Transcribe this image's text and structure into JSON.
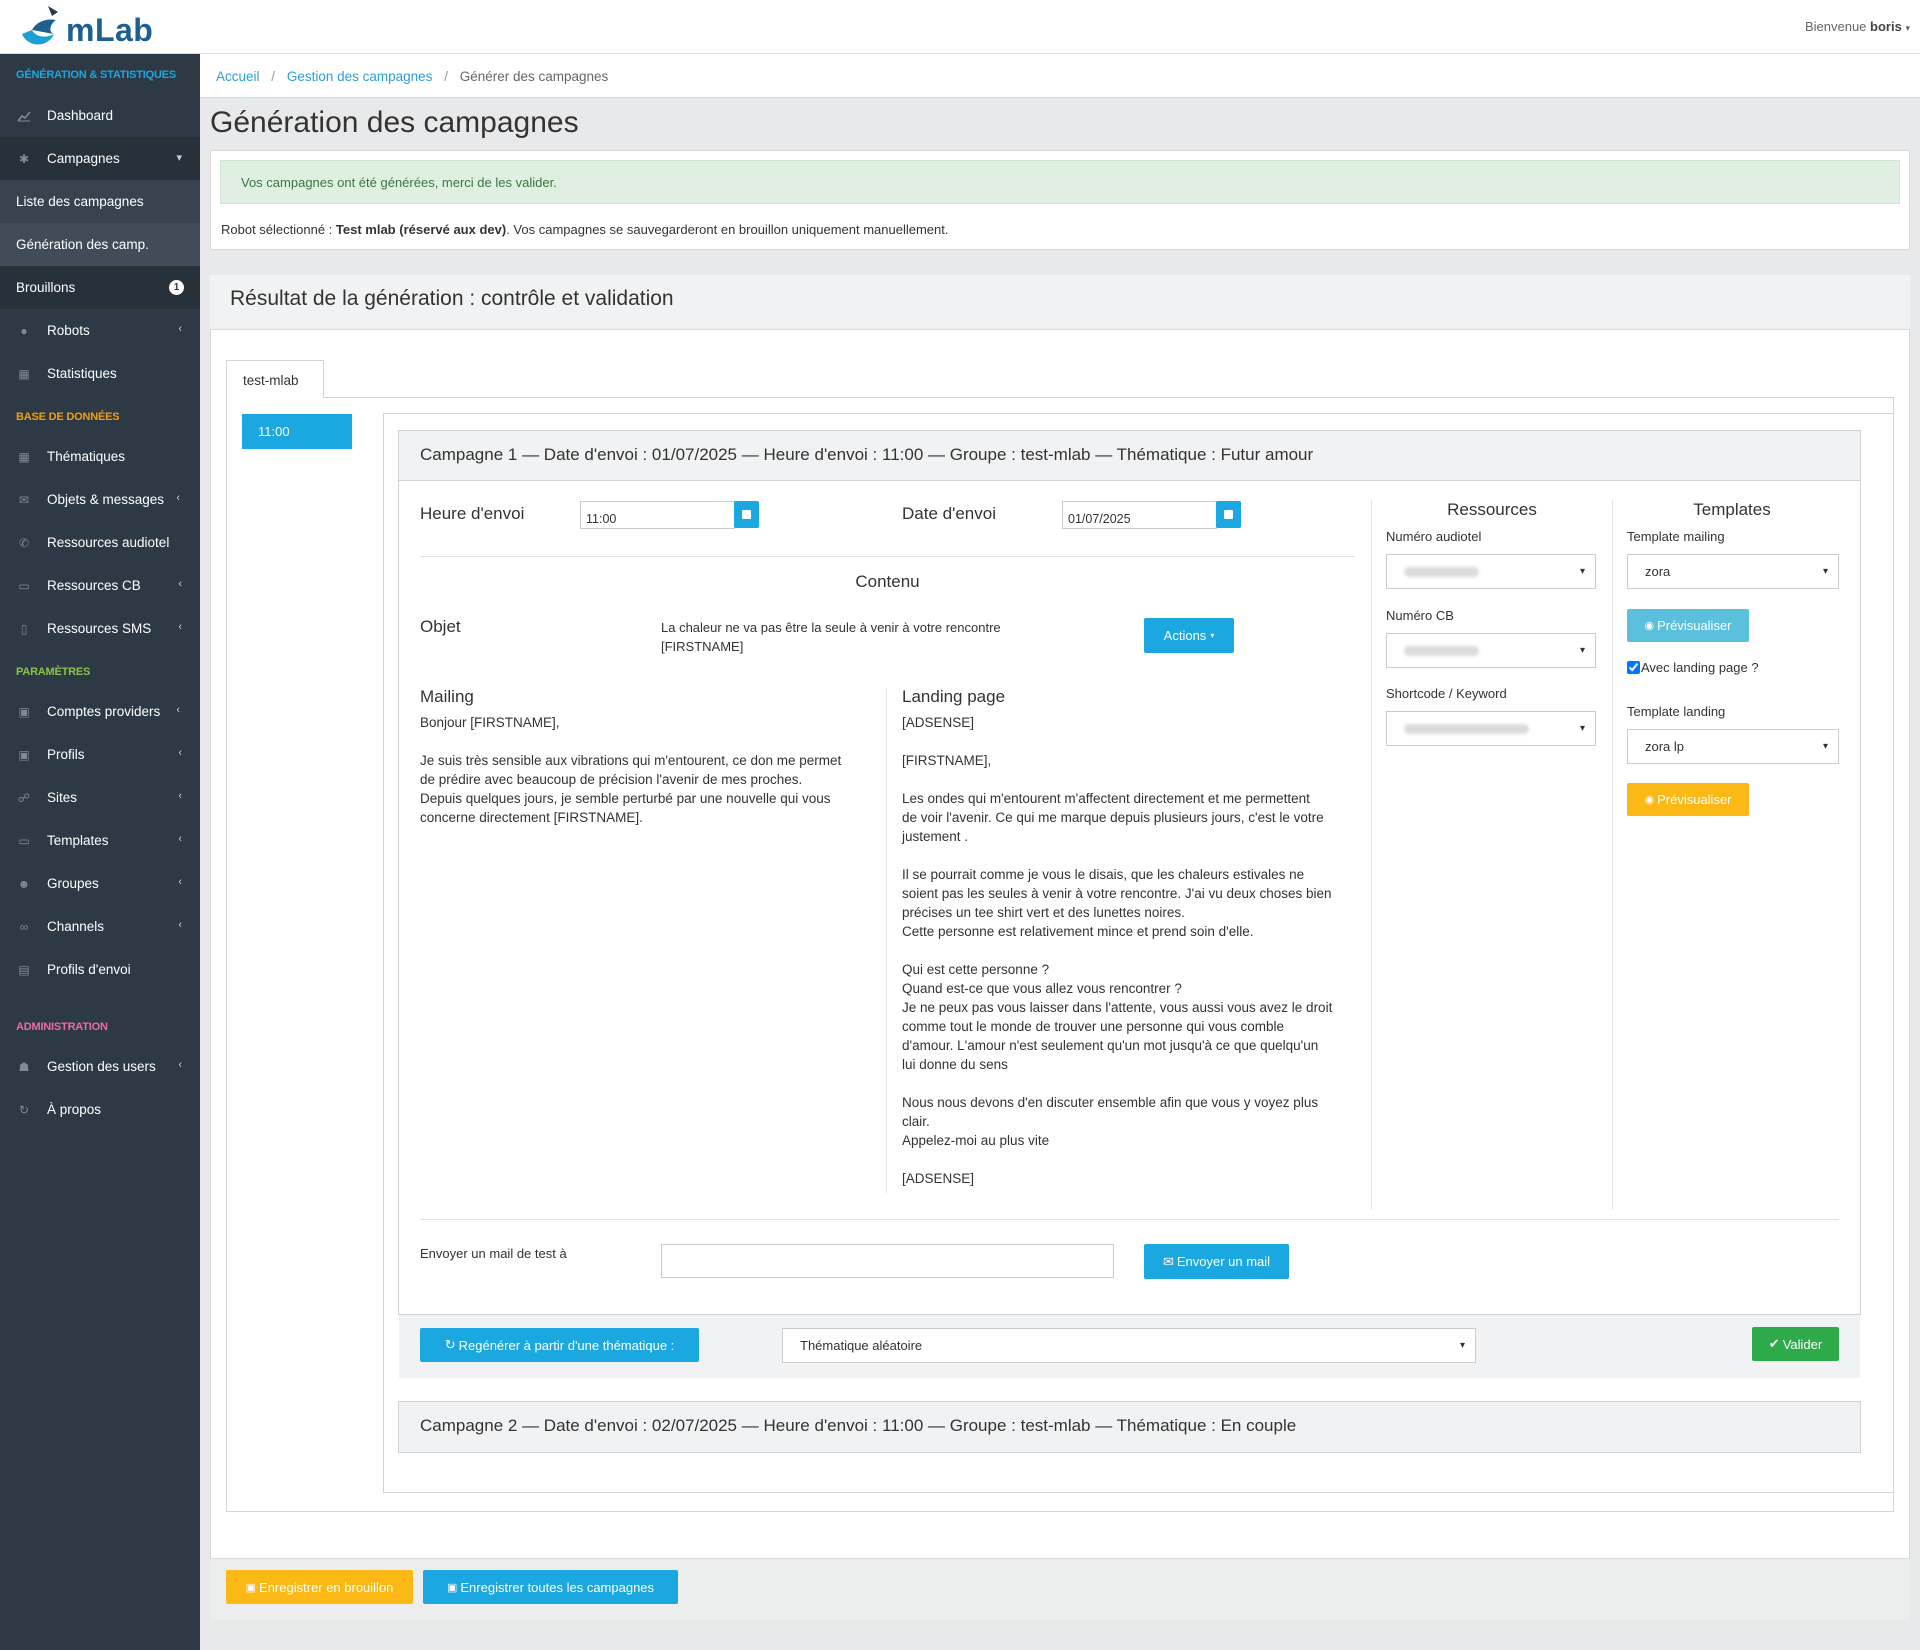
{
  "app": {
    "logo": "mLab",
    "welcome_prefix": "Bienvenue",
    "user": "boris"
  },
  "colors": {
    "accent": "#1ba8e0",
    "sidebar_bg": "#2d3a45",
    "section_blue": "#1ba8e0",
    "section_orange": "#f39c12",
    "section_green": "#8bc34a",
    "section_pink": "#e96ba8"
  },
  "sidebar": {
    "sections": [
      {
        "label": "GÉNÉRATION & STATISTIQUES"
      },
      {
        "label": "BASE DE DONNÉES"
      },
      {
        "label": "PARAMÈTRES"
      },
      {
        "label": "ADMINISTRATION"
      }
    ],
    "items": [
      {
        "label": "Dashboard",
        "icon": "chart-line-icon"
      },
      {
        "label": "Campagnes",
        "icon": "asterisk-icon"
      },
      {
        "label": "Liste des campagnes"
      },
      {
        "label": "Génération des camp."
      },
      {
        "label": "Brouillons",
        "badge": "1"
      },
      {
        "label": "Robots",
        "icon": "robot-icon"
      },
      {
        "label": "Statistiques",
        "icon": "table-icon"
      },
      {
        "label": "Thématiques",
        "icon": "grid-icon"
      },
      {
        "label": "Objets & messages",
        "icon": "envelope-icon"
      },
      {
        "label": "Ressources audiotel",
        "icon": "phone-icon"
      },
      {
        "label": "Ressources CB",
        "icon": "credit-card-icon"
      },
      {
        "label": "Ressources SMS",
        "icon": "mobile-icon"
      },
      {
        "label": "Comptes providers",
        "icon": "id-badge-icon"
      },
      {
        "label": "Profils",
        "icon": "user-card-icon"
      },
      {
        "label": "Sites",
        "icon": "sitemap-icon"
      },
      {
        "label": "Templates",
        "icon": "desktop-icon"
      },
      {
        "label": "Groupes",
        "icon": "users-icon"
      },
      {
        "label": "Channels",
        "icon": "link-icon"
      },
      {
        "label": "Profils d'envoi",
        "icon": "id-card-icon"
      },
      {
        "label": "Gestion des users",
        "icon": "user-icon"
      },
      {
        "label": "À propos",
        "icon": "refresh-icon"
      }
    ],
    "chevron_open": "▾",
    "chevron_closed": "‹"
  },
  "breadcrumb": {
    "home": "Accueil",
    "level2": "Gestion des campagnes",
    "current": "Générer des campagnes",
    "sep": "/"
  },
  "page": {
    "title": "Génération des campagnes",
    "alert": "Vos campagnes ont été générées, merci de les valider.",
    "robot_prefix": "Robot sélectionné : ",
    "robot_name": "Test mlab (réservé aux dev)",
    "robot_suffix": ". Vos campagnes se sauvegarderont en brouillon uniquement manuellement.",
    "result_title": "Résultat de la génération : contrôle et validation",
    "tab": "test-mlab",
    "time_slot": "11:00"
  },
  "campaign1": {
    "header": "Campagne 1 — Date d'envoi : 01/07/2025 — Heure d'envoi : 11:00 — Groupe : test-mlab — Thématique : Futur amour",
    "heure_label": "Heure d'envoi",
    "heure_value": "11:00",
    "date_label": "Date d'envoi",
    "date_value": "01/07/2025",
    "contenu_title": "Contenu",
    "objet_label": "Objet",
    "objet_line1": "La chaleur ne va pas être la seule à venir à votre rencontre",
    "objet_line2": "[FIRSTNAME]",
    "actions_label": "Actions",
    "mailing_title": "Mailing",
    "mailing_lines": [
      "Bonjour [FIRSTNAME],",
      "",
      "Je suis très sensible aux vibrations qui m'entourent, ce don me permet",
      "de prédire avec beaucoup de précision l'avenir de mes proches.",
      "Depuis quelques jours, je semble perturbé par une nouvelle qui vous",
      "concerne directement [FIRSTNAME]."
    ],
    "landing_title": "Landing page",
    "landing_lines": [
      "[ADSENSE]",
      "",
      "[FIRSTNAME],",
      "",
      "Les ondes qui m'entourent m'affectent directement et me permettent",
      "de voir l'avenir. Ce qui me marque depuis plusieurs jours, c'est le votre",
      "justement .",
      "",
      "Il se pourrait comme je vous le disais, que les chaleurs estivales ne",
      "soient pas les seules à venir à votre rencontre. J'ai vu deux choses bien",
      "précises un tee shirt vert et des lunettes noires.",
      "Cette personne est relativement mince et prend soin d'elle.",
      "",
      "Qui est cette personne ?",
      "Quand est-ce que vous allez vous rencontrer ?",
      "Je ne peux pas vous laisser dans l'attente, vous aussi vous avez le droit",
      "comme tout le monde de trouver une personne qui vous comble",
      "d'amour. L'amour n'est seulement qu'un mot jusqu'à ce que quelqu'un",
      "lui donne du sens",
      "",
      "Nous nous devons d'en discuter ensemble afin que vous y voyez plus",
      "clair.",
      "Appelez-moi au plus vite",
      "",
      "[ADSENSE]"
    ],
    "ressources_title": "Ressources",
    "audiotel_label": "Numéro audiotel",
    "cb_label": "Numéro CB",
    "shortcode_label": "Shortcode / Keyword",
    "templates_title": "Templates",
    "template_mailing_label": "Template mailing",
    "template_mailing_value": "zora",
    "preview_label": "Prévisualiser",
    "landing_check_label": "Avec landing page ?",
    "landing_checked": true,
    "template_landing_label": "Template landing",
    "template_landing_value": "zora lp",
    "test_mail_label": "Envoyer un mail de test à",
    "test_mail_value": "",
    "send_mail_label": "Envoyer un mail",
    "regen_label": "Regénérer à partir d'une thématique :",
    "theme_select": "Thématique aléatoire",
    "validate_label": "Valider"
  },
  "campaign2": {
    "header": "Campagne 2 — Date d'envoi : 02/07/2025 — Heure d'envoi : 11:00 — Groupe : test-mlab — Thématique : En couple"
  },
  "footer": {
    "draft_label": "Enregistrer en brouillon",
    "save_all_label": "Enregistrer toutes les campagnes"
  }
}
